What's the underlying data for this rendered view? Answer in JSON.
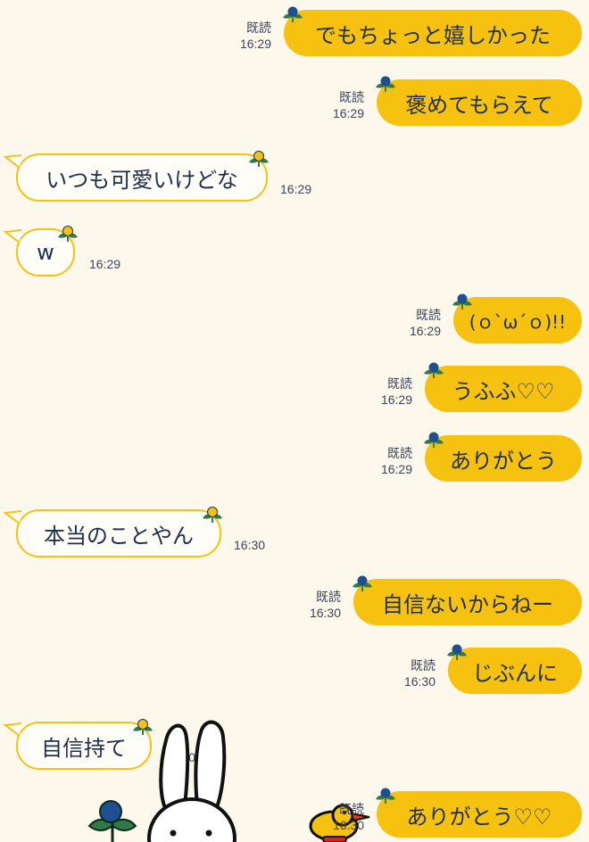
{
  "messages": [
    {
      "dir": "out",
      "text": "でもちょっと嬉しかった",
      "read": "既読",
      "time": "16:29"
    },
    {
      "dir": "out",
      "text": "褒めてもらえて",
      "read": "既読",
      "time": "16:29"
    },
    {
      "dir": "in",
      "text": "いつも可愛いけどな",
      "time": "16:29"
    },
    {
      "dir": "in",
      "text": "w",
      "time": "16:29"
    },
    {
      "dir": "out",
      "text": "(ｏ`ω´ｏ)!!",
      "read": "既読",
      "time": "16:29"
    },
    {
      "dir": "out",
      "text": "うふふ♡♡",
      "read": "既読",
      "time": "16:29"
    },
    {
      "dir": "out",
      "text": "ありがとう",
      "read": "既読",
      "time": "16:29"
    },
    {
      "dir": "in",
      "text": "本当のことやん",
      "time": "16:30"
    },
    {
      "dir": "out",
      "text": "自信ないからねー",
      "read": "既読",
      "time": "16:30"
    },
    {
      "dir": "out",
      "text": "じぶんに",
      "read": "既読",
      "time": "16:30"
    },
    {
      "dir": "in",
      "text": "自信持て",
      "time": "16:30"
    },
    {
      "dir": "out",
      "text": "ありがとう♡♡",
      "read": "既読",
      "time": "16:30"
    }
  ],
  "colors": {
    "background": "#fdf8ec",
    "bubble_out": "#f6c20f",
    "bubble_in_border": "#f6c20f",
    "text": "#1f2f4a",
    "flower_out": "#1d4f91",
    "flower_in": "#f6c20f",
    "leaf": "#2f7a4a"
  },
  "icons": {
    "flower_out": "navy-flower-icon",
    "flower_in": "yellow-flower-icon",
    "bunny": "miffy-bunny-icon",
    "duck": "yellow-duck-icon",
    "tulip": "blue-tulip-icon"
  }
}
